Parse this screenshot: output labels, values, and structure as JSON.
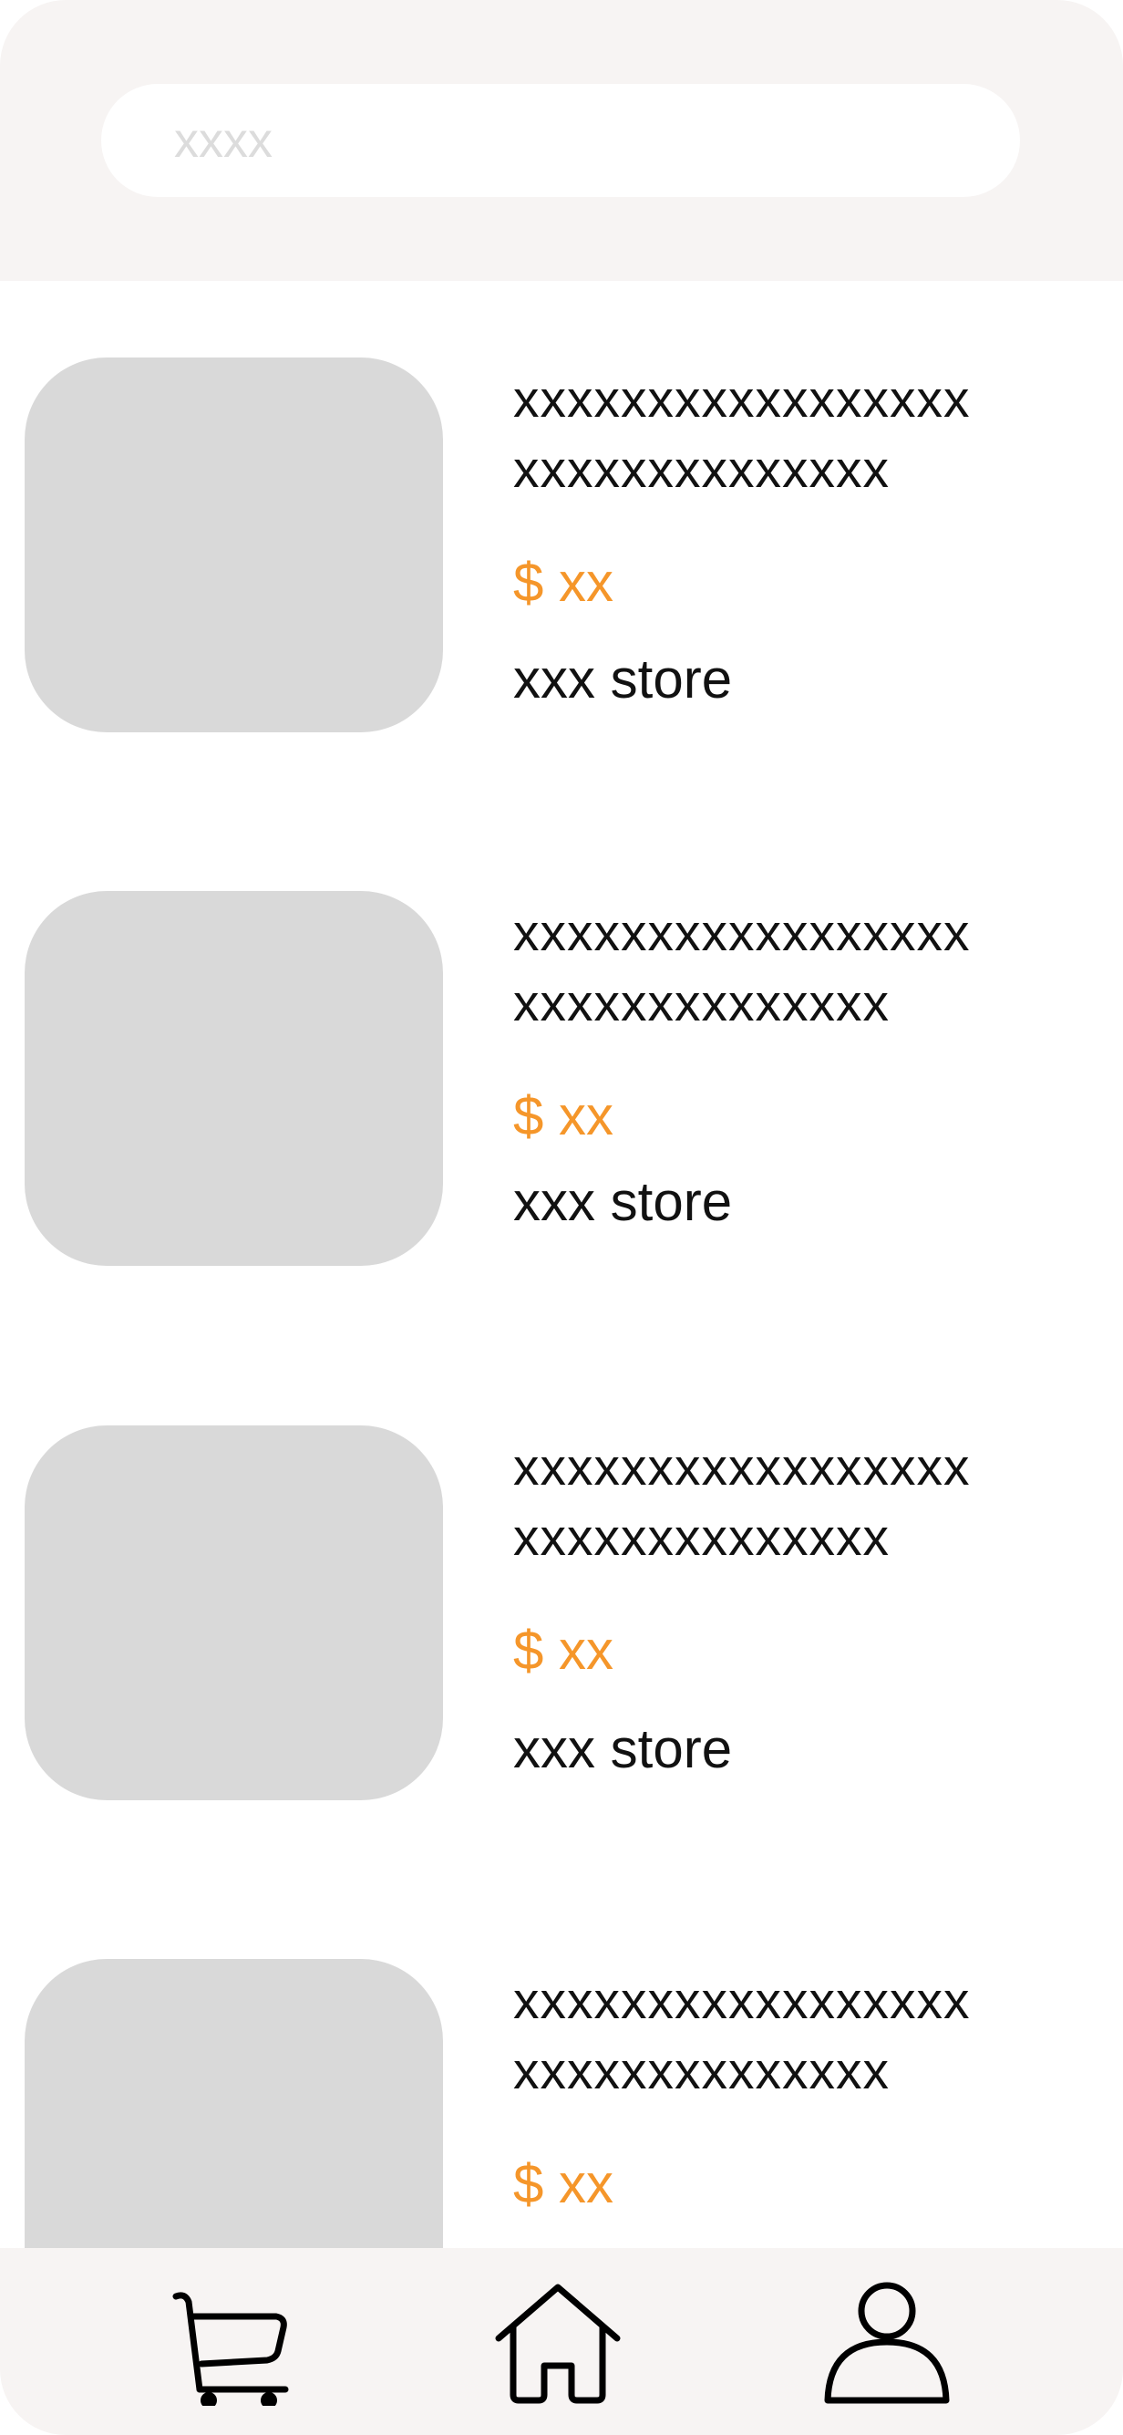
{
  "search": {
    "placeholder": "xxxx",
    "icon": "none"
  },
  "products": [
    {
      "title": "xxxxxxxxxxxxxxxxx\nxxxxxxxxxxxxxx",
      "price": "$ xx",
      "store": "xxx store"
    },
    {
      "title": "xxxxxxxxxxxxxxxxx\nxxxxxxxxxxxxxx",
      "price": "$ xx",
      "store": "xxx store"
    },
    {
      "title": "xxxxxxxxxxxxxxxxx\nxxxxxxxxxxxxxx",
      "price": "$ xx",
      "store": "xxx store"
    },
    {
      "title": "xxxxxxxxxxxxxxxxx\nxxxxxxxxxxxxxx",
      "price": "$ xx",
      "store": ""
    }
  ],
  "tabs": [
    {
      "icon": "cart-icon"
    },
    {
      "icon": "home-icon"
    },
    {
      "icon": "profile-icon"
    }
  ],
  "colors": {
    "header_bg": "#f7f4f3",
    "thumbnail": "#d9d9d9",
    "price": "#f5962a",
    "placeholder": "#dcdcdc"
  }
}
